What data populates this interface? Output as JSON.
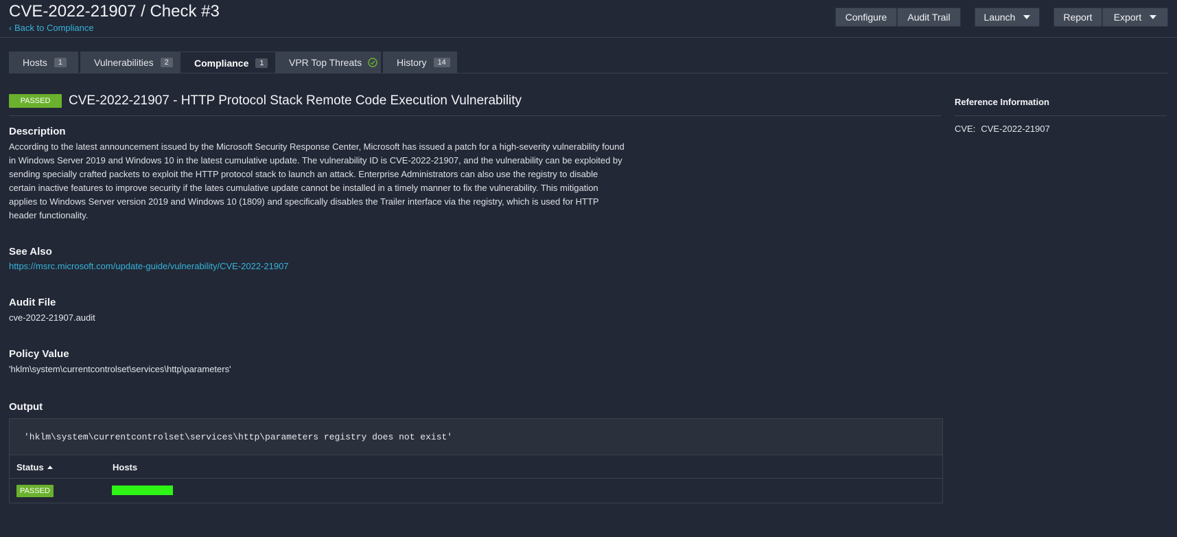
{
  "header": {
    "title": "CVE-2022-21907 / Check #3",
    "back_link": "Back to Compliance",
    "buttons": {
      "configure": "Configure",
      "audit_trail": "Audit Trail",
      "launch": "Launch",
      "report": "Report",
      "export": "Export"
    }
  },
  "tabs": [
    {
      "label": "Hosts",
      "count": "1"
    },
    {
      "label": "Vulnerabilities",
      "count": "2"
    },
    {
      "label": "Compliance",
      "count": "1"
    },
    {
      "label": "VPR Top Threats"
    },
    {
      "label": "History",
      "count": "14"
    }
  ],
  "check": {
    "result_badge": "PASSED",
    "title": "CVE-2022-21907 - HTTP Protocol Stack Remote Code Execution Vulnerability"
  },
  "sections": {
    "description_heading": "Description",
    "description": "According to the latest announcement issued by the Microsoft Security Response Center, Microsoft has issued a patch for a high-severity vulnerability found in Windows Server 2019 and Windows 10 in the latest cumulative update. The vulnerability ID is CVE-2022-21907, and the vulnerability can be exploited by sending specially crafted packets to exploit the HTTP protocol stack to launch an attack. Enterprise Administrators can also use the registry to disable certain inactive features to improve security if the lates cumulative update cannot be installed in a timely manner to fix the vulnerability. This mitigation applies to Windows Server version 2019 and Windows 10 (1809) and specifically disables the Trailer interface via the registry, which is used for HTTP header functionality.",
    "see_also_heading": "See Also",
    "see_also_link": "https://msrc.microsoft.com/update-guide/vulnerability/CVE-2022-21907",
    "audit_file_heading": "Audit File",
    "audit_file": "cve-2022-21907.audit",
    "policy_value_heading": "Policy Value",
    "policy_value": "'hklm\\system\\currentcontrolset\\services\\http\\parameters'",
    "output_heading": "Output",
    "output_text": "'hklm\\system\\currentcontrolset\\services\\http\\parameters registry does not exist'"
  },
  "results_table": {
    "columns": [
      "Status",
      "Hosts"
    ],
    "rows": [
      {
        "status": "PASSED",
        "hosts_fraction": 1.0,
        "bar_color": "#2ef516"
      }
    ]
  },
  "reference": {
    "heading": "Reference Information",
    "cve_label": "CVE:",
    "cve_value": "CVE-2022-21907"
  },
  "colors": {
    "background": "#222836",
    "accent_link": "#37b3da",
    "passed": "#6ab12d",
    "vpr_check": "#6ab12d"
  },
  "icons": {
    "back": "chevron-left-icon",
    "vpr": "check-circle-icon",
    "sort": "sort-ascending-icon",
    "dropdown": "caret-down-icon"
  }
}
